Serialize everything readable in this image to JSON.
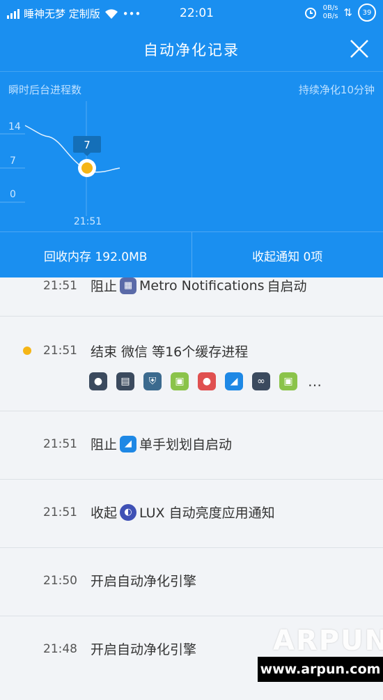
{
  "status_bar": {
    "carrier": "睡神无梦 定制版",
    "time": "22:01",
    "net_up": "0B/s",
    "net_down": "0B/s",
    "battery": "39"
  },
  "header": {
    "title": "自动净化记录"
  },
  "chart": {
    "left_label": "瞬时后台进程数",
    "right_label": "持续净化10分钟",
    "y_ticks": [
      "14",
      "7",
      "0"
    ],
    "x_label": "21:51",
    "tooltip": "7",
    "chart_data": {
      "type": "line",
      "title": "",
      "ylim": [
        0,
        14
      ],
      "y_ticks": [
        14,
        7,
        0
      ],
      "x_tick_labels": [
        "21:51"
      ],
      "highlight_value": 7
    }
  },
  "summary": {
    "memory": "回收内存 192.0MB",
    "notifications": "收起通知 0项"
  },
  "records": [
    {
      "time": "21:51",
      "prefix": "阻止",
      "app": "Metro Notifications",
      "suffix": "自启动",
      "icon": "metro-icon",
      "color": "#5a6aa8"
    },
    {
      "time": "21:51",
      "text": "结束 微信 等16个缓存进程",
      "highlight": true
    },
    {
      "time": "21:51",
      "prefix": "阻止",
      "app": "",
      "suffix": "单手划划自启动",
      "icon": "swipe-app-icon",
      "color": "#1e88e5"
    },
    {
      "time": "21:51",
      "prefix": "收起",
      "app": "LUX 自动亮度应用通知",
      "suffix": "",
      "icon": "lux-icon",
      "color": "#3f51b5"
    },
    {
      "time": "21:50",
      "text": "开启自动净化引擎"
    },
    {
      "time": "21:48",
      "text": "开启自动净化引擎"
    }
  ],
  "cache_apps": [
    {
      "icon": "wechat-icon",
      "bg": "#3b4a5e",
      "glyph": "●"
    },
    {
      "icon": "news-icon",
      "bg": "#3b4a5e",
      "glyph": "▤"
    },
    {
      "icon": "shield-app-icon",
      "bg": "#3b6a8e",
      "glyph": "⛨"
    },
    {
      "icon": "android-icon",
      "bg": "#8bc34a",
      "glyph": "▣"
    },
    {
      "icon": "contacts-icon",
      "bg": "#e05050",
      "glyph": "●"
    },
    {
      "icon": "swipe-app-icon",
      "bg": "#1e88e5",
      "glyph": "◢"
    },
    {
      "icon": "owl-app-icon",
      "bg": "#3b4a5e",
      "glyph": "∞"
    },
    {
      "icon": "android-icon",
      "bg": "#8bc34a",
      "glyph": "▣"
    }
  ],
  "more": "…",
  "watermark": {
    "logo": "ARPUN",
    "url": "www.arpun.com"
  }
}
